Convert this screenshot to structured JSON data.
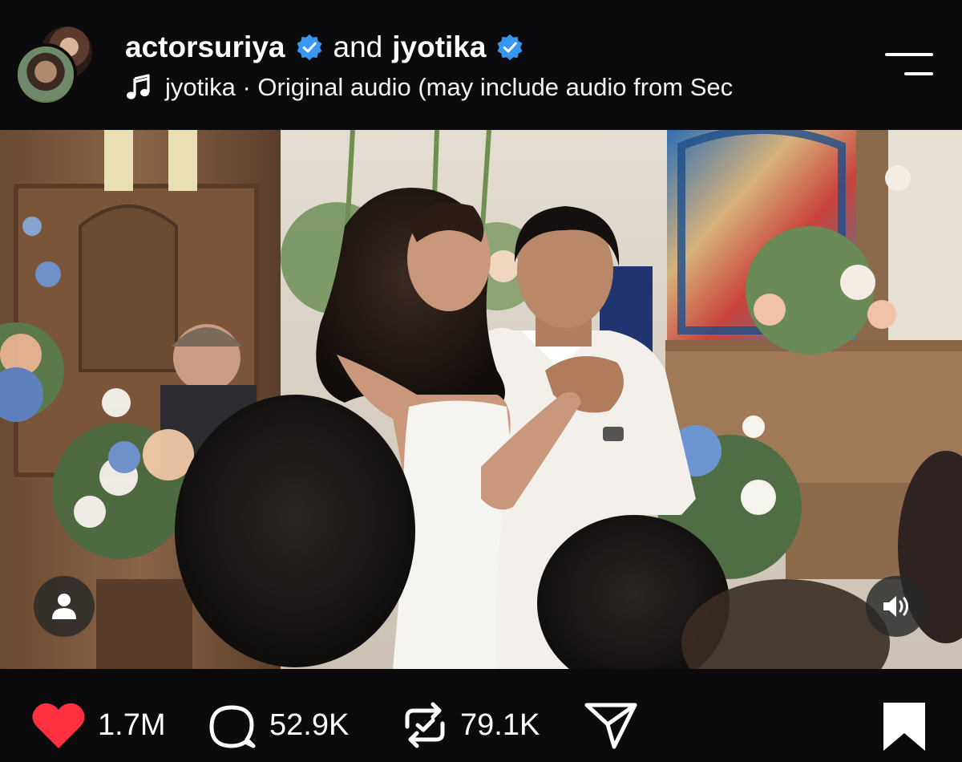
{
  "header": {
    "user1": "actorsuriya",
    "connector": "and",
    "user2": "jyotika",
    "audio_text": "jyotika · Original audio  (may include audio from Sec"
  },
  "actions": {
    "likes": "1.7M",
    "comments": "52.9K",
    "reposts": "79.1K"
  },
  "icons": {
    "verified": "verified-badge-icon",
    "audio": "music-note-icon",
    "menu": "menu-icon",
    "tagged_user": "user-icon",
    "volume": "volume-icon",
    "like": "heart-icon",
    "comment": "comment-icon",
    "repost": "repost-icon",
    "share": "send-icon",
    "save": "bookmark-icon"
  },
  "colors": {
    "background": "#0b0b0d",
    "verified": "#3897f0",
    "like": "#ff3040",
    "text": "#ffffff"
  }
}
